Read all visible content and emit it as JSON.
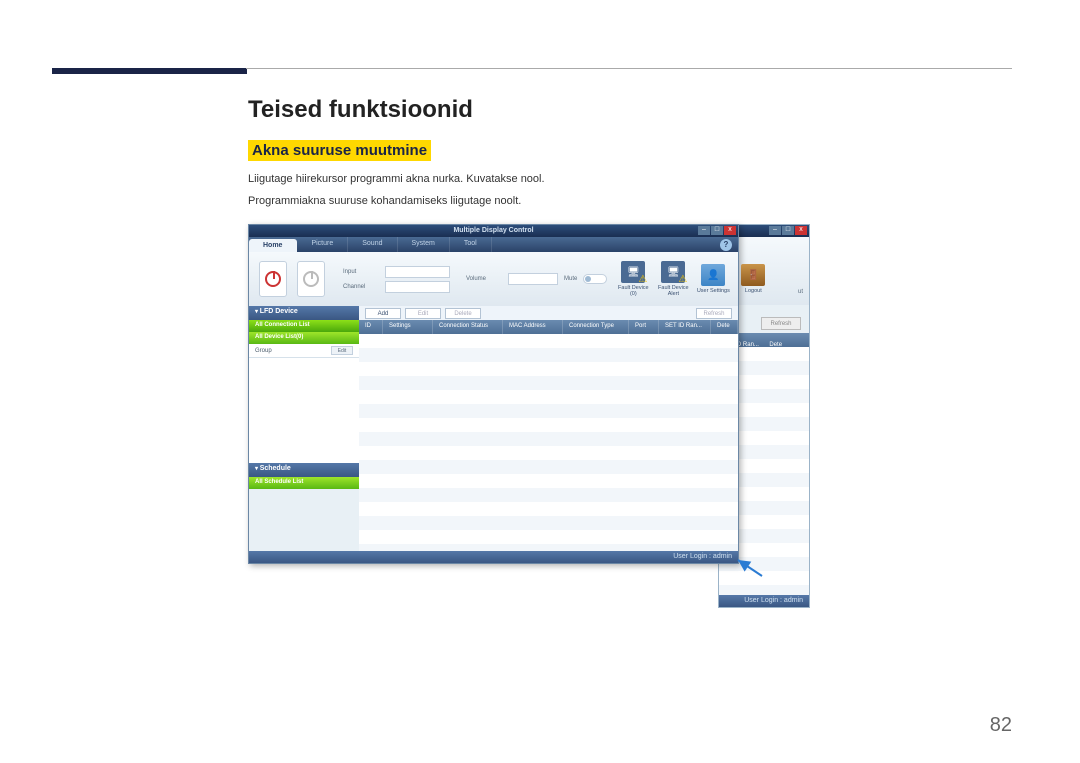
{
  "doc": {
    "heading1": "Teised funktsioonid",
    "heading2": "Akna suuruse muutmine",
    "para1": "Liigutage hiirekursor programmi akna nurka. Kuvatakse nool.",
    "para2": "Programmiakna suuruse kohandamiseks liigutage noolt.",
    "page_number": "82"
  },
  "app": {
    "title": "Multiple Display Control",
    "tabs": [
      "Home",
      "Picture",
      "Sound",
      "System",
      "Tool"
    ],
    "help": "?",
    "info": {
      "input_label": "Input",
      "channel_label": "Channel",
      "volume_label": "Volume",
      "input_value": "",
      "channel_value": "",
      "mute_label": "Mute"
    },
    "tool_icons": {
      "fault_device": "Fault Device (0)",
      "fault_alert": "Fault Device Alert",
      "user_settings": "User Settings",
      "logout": "Logout"
    },
    "sidebar": {
      "lfd_header": "LFD Device",
      "all_connection": "All Connection List",
      "all_device": "All Device List(0)",
      "group": "Group",
      "edit": "Edit",
      "schedule_header": "Schedule",
      "all_schedule": "All Schedule List"
    },
    "actions": {
      "add": "Add",
      "edit": "Edit",
      "delete": "Delete",
      "refresh": "Refresh"
    },
    "columns": {
      "id": "ID",
      "settings": "Settings",
      "conn_status": "Connection Status",
      "mac": "MAC Address",
      "conn_type": "Connection Type",
      "port": "Port",
      "set_id": "SET ID Ran...",
      "dete": "Dete"
    },
    "status": "User Login : admin",
    "bg_status": "User Login : admin",
    "bg_refresh": "Refresh",
    "bg_col_setid": "SET ID Ran...",
    "bg_col_dete": "Dete",
    "bg_ut": "ut"
  }
}
